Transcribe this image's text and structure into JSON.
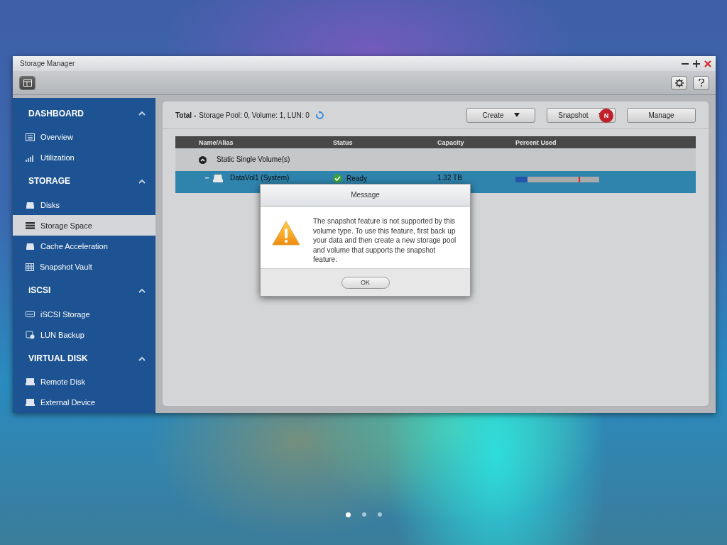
{
  "window": {
    "title": "Storage Manager"
  },
  "sidebar": {
    "sections": [
      {
        "title": "DASHBOARD",
        "expanded": true,
        "items": [
          {
            "label": "Overview",
            "selected": false
          },
          {
            "label": "Utilization",
            "selected": false
          }
        ]
      },
      {
        "title": "STORAGE",
        "expanded": true,
        "items": [
          {
            "label": "Disks",
            "selected": false
          },
          {
            "label": "Storage Space",
            "selected": true
          },
          {
            "label": "Cache Acceleration",
            "selected": false
          },
          {
            "label": "Snapshot Vault",
            "selected": false
          }
        ]
      },
      {
        "title": "iSCSI",
        "expanded": true,
        "items": [
          {
            "label": "iSCSI Storage",
            "selected": false
          },
          {
            "label": "LUN Backup",
            "selected": false
          }
        ]
      },
      {
        "title": "VIRTUAL DISK",
        "expanded": true,
        "items": [
          {
            "label": "Remote Disk",
            "selected": false
          },
          {
            "label": "External Device",
            "selected": false
          }
        ]
      }
    ]
  },
  "summary": {
    "label": "Total -",
    "text": "Storage Pool: 0, Volume: 1, LUN: 0"
  },
  "actions": [
    {
      "label": "Create",
      "dropdown": true
    },
    {
      "label": "Snapshot",
      "dropdown": true,
      "badge": "N"
    },
    {
      "label": "Manage",
      "dropdown": false
    }
  ],
  "table": {
    "columns": [
      "Name/Alias",
      "Status",
      "Capacity",
      "Percent Used"
    ],
    "groups": [
      {
        "label": "Static Single Volume(s)",
        "expanded": true,
        "rows": [
          {
            "name": "DataVol1 (System)",
            "status": "Ready",
            "capacity": "1.32 TB",
            "level": 0.14,
            "selected": true
          }
        ]
      }
    ]
  },
  "dialog": {
    "title": "Message",
    "message": "The snapshot feature is not supported by this volume type. To use this feature, first back up your data and then create a new storage pool and volume that supports the snapshot feature.",
    "button": "OK"
  },
  "page_dots": [
    {
      "selected": true
    },
    {
      "selected": false
    },
    {
      "selected": false
    }
  ]
}
